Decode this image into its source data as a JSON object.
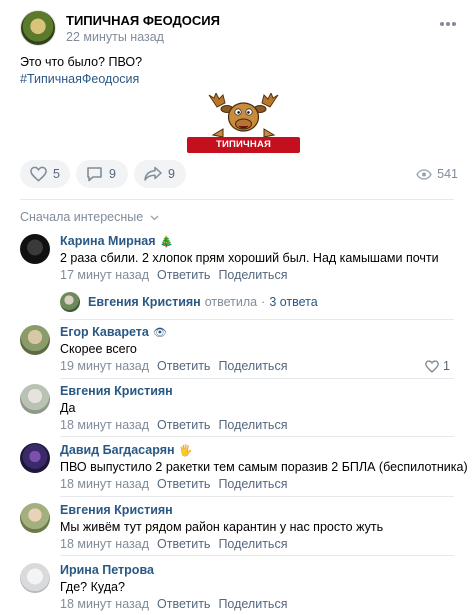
{
  "post": {
    "group_name": "ТИПИЧНАЯ ФЕОДОСИЯ",
    "time": "22 минуты назад",
    "text_line1": "Это что было? ПВО?",
    "hashtag": "#ТипичнаяФеодосия",
    "image_banner": "ТИПИЧНАЯ ФЕОДОСИЯ",
    "likes": "5",
    "comments": "9",
    "shares": "9",
    "views": "541"
  },
  "comments_section": {
    "sort_label": "Сначала интересные"
  },
  "comments": [
    {
      "name": "Карина Мирная",
      "badge": "🎄",
      "text": "2 раза сбили. 2 хлопок прям хороший был. Над камышами почти",
      "time": "17 минут назад",
      "reply_label": "Ответить",
      "share_label": "Поделиться"
    },
    {
      "name": "Егор Каварета",
      "badge": "👁",
      "text": "Скорее всего",
      "time": "19 минут назад",
      "reply_label": "Ответить",
      "share_label": "Поделиться",
      "likes": "1"
    },
    {
      "name": "Евгения Кристиян",
      "badge": "",
      "text": "Да",
      "time": "18 минут назад",
      "reply_label": "Ответить",
      "share_label": "Поделиться"
    },
    {
      "name": "Давид Багдасарян",
      "badge": "🖐",
      "text": "ПВО выпустило 2 ракетки тем самым поразив 2 БПЛА (беспилотника)",
      "time": "18 минут назад",
      "reply_label": "Ответить",
      "share_label": "Поделиться"
    },
    {
      "name": "Евгения Кристиян",
      "badge": "",
      "text": "Мы живём тут рядом район карантин у нас просто жуть",
      "time": "18 минут назад",
      "reply_label": "Ответить",
      "share_label": "Поделиться"
    },
    {
      "name": "Ирина Петрова",
      "badge": "",
      "text": "Где? Куда?",
      "time": "18 минут назад",
      "reply_label": "Ответить",
      "share_label": "Поделиться"
    }
  ],
  "reply_thread": {
    "name": "Евгения Кристиян",
    "action": "ответила",
    "separator": "·",
    "count": "3 ответа"
  }
}
